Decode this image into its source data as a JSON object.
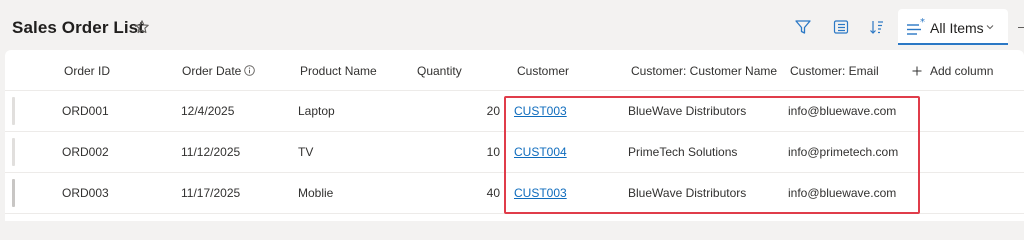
{
  "page": {
    "title": "Sales Order List"
  },
  "toolbar": {
    "view_label": "All Items"
  },
  "columns": [
    {
      "label": "Order ID"
    },
    {
      "label": "Order Date"
    },
    {
      "label": "Product Name"
    },
    {
      "label": "Quantity"
    },
    {
      "label": "Customer"
    },
    {
      "label": "Customer: Customer Name"
    },
    {
      "label": "Customer: Email"
    }
  ],
  "add_column_label": "Add column",
  "rows": [
    {
      "order_id": "ORD001",
      "order_date": "12/4/2025",
      "product": "Laptop",
      "quantity": "20",
      "customer": "CUST003",
      "customer_name": "BlueWave Distributors",
      "email": "info@bluewave.com"
    },
    {
      "order_id": "ORD002",
      "order_date": "11/12/2025",
      "product": "TV",
      "quantity": "10",
      "customer": "CUST004",
      "customer_name": "PrimeTech Solutions",
      "email": "info@primetech.com"
    },
    {
      "order_id": "ORD003",
      "order_date": "11/17/2025",
      "product": "Moblie",
      "quantity": "40",
      "customer": "CUST003",
      "customer_name": "BlueWave Distributors",
      "email": "info@bluewave.com"
    }
  ],
  "icons": {
    "favorite": "star-icon",
    "filter": "filter-icon",
    "edit_columns": "column-list-icon",
    "sort": "sort-icon",
    "view": "view-lines-icon",
    "info": "info-icon",
    "add": "plus-icon"
  },
  "colors": {
    "accent": "#2b78c5",
    "link": "#0f6cbd",
    "highlight_box": "#e03c4a"
  }
}
